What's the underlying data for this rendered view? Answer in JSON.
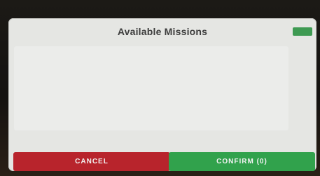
{
  "dialog": {
    "title": "Available Missions",
    "cancel_label": "CANCEL",
    "confirm_label": "CONFIRM (0)"
  },
  "colors": {
    "cancel": "#b8242c",
    "confirm": "#31a24c",
    "toggle": "#3e9a52",
    "panel": "#e5e6e3"
  }
}
